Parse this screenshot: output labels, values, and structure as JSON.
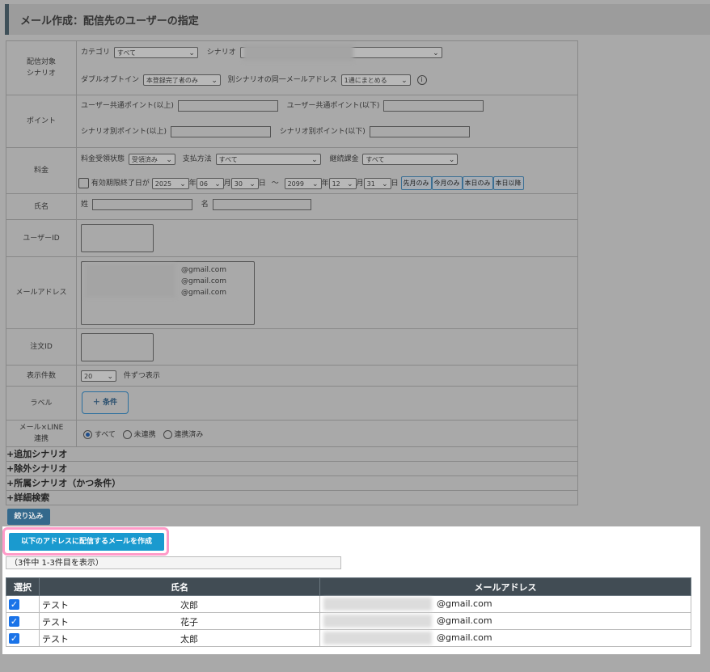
{
  "page": {
    "title": "メール作成：配信先のユーザーの指定"
  },
  "form": {
    "scenario": {
      "label": "配信対象\nシナリオ",
      "category_label": "カテゴリ",
      "category_value": "すべて",
      "scenario_label": "シナリオ",
      "double_optin_label": "ダブルオプトイン",
      "double_optin_value": "本登録完了者のみ",
      "same_mail_label": "別シナリオの同一メールアドレス",
      "same_mail_value": "1通にまとめる"
    },
    "point": {
      "label": "ポイント",
      "common_min": "ユーザー共通ポイント(以上)",
      "common_max": "ユーザー共通ポイント(以下)",
      "scenario_min": "シナリオ別ポイント(以上)",
      "scenario_max": "シナリオ別ポイント(以下)"
    },
    "fee": {
      "label": "料金",
      "receipt_label": "料金受領状態",
      "receipt_value": "受領済み",
      "payment_label": "支払方法",
      "payment_value": "すべて",
      "billing_label": "継続課金",
      "billing_value": "すべて",
      "expiry_label": "有効期限終了日が",
      "from_year": "2025",
      "from_month": "06",
      "from_day": "30",
      "to_year": "2099",
      "to_month": "12",
      "to_day": "31",
      "year_unit": "年",
      "month_unit": "月",
      "day_unit": "日",
      "tilde": "～",
      "btn_last_month": "先月のみ",
      "btn_this_month": "今月のみ",
      "btn_today": "本日のみ",
      "btn_after_today": "本日以降"
    },
    "name": {
      "label": "氏名",
      "last_label": "姓",
      "first_label": "名"
    },
    "user_id": {
      "label": "ユーザーID"
    },
    "email": {
      "label": "メールアドレス",
      "lines": [
        "@gmail.com",
        "@gmail.com",
        "@gmail.com"
      ]
    },
    "order_id": {
      "label": "注文ID"
    },
    "display_count": {
      "label": "表示件数",
      "value": "20",
      "suffix": "件ずつ表示"
    },
    "tag": {
      "label": "ラベル",
      "button": "＋ 条件"
    },
    "line": {
      "label": "メール×LINE\n連携",
      "options": [
        "すべて",
        "未連携",
        "連携済み"
      ],
      "selected": "すべて"
    },
    "sections": [
      "+追加シナリオ",
      "+除外シナリオ",
      "+所属シナリオ（かつ条件）",
      "+詳細検索"
    ],
    "filter_button": "絞り込み"
  },
  "result": {
    "create_button": "以下のアドレスに配信するメールを作成",
    "count_text": "（3件中 1-3件目を表示）",
    "headers": [
      "選択",
      "氏名",
      "メールアドレス"
    ],
    "rows": [
      {
        "checked": true,
        "last": "テスト",
        "first": "次郎",
        "email": "@gmail.com"
      },
      {
        "checked": true,
        "last": "テスト",
        "first": "花子",
        "email": "@gmail.com"
      },
      {
        "checked": true,
        "last": "テスト",
        "first": "太郎",
        "email": "@gmail.com"
      }
    ]
  },
  "colors": {
    "accent": "#1a9acf",
    "highlight": "#ff9ac8",
    "header_bg": "#414c54",
    "overlay": "#a9a9a9"
  }
}
